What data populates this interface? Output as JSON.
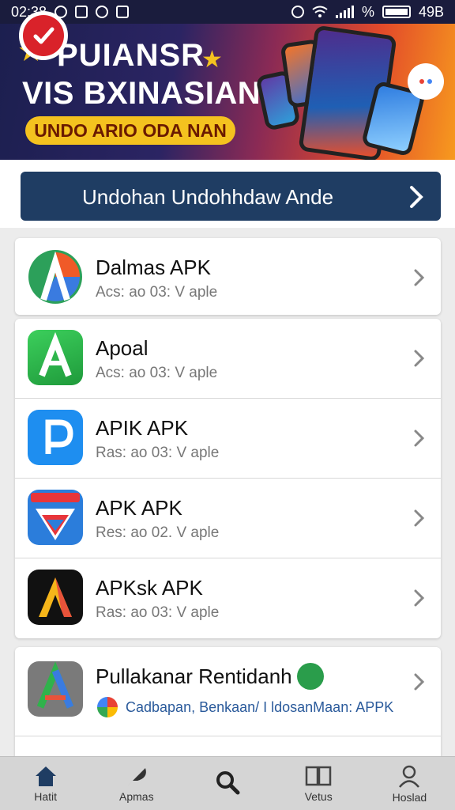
{
  "status_bar": {
    "time": "02:38",
    "battery_percent": "%",
    "right_text": "49B"
  },
  "banner": {
    "line1": "PUIANSR",
    "line2": "VIS BXINASIAN",
    "sub": "UNDO ARIO ODA NAN"
  },
  "download_bar": {
    "label": "Undohan Undohhdaw Ande"
  },
  "apps": [
    {
      "title": "Dalmas APK",
      "subtitle": "Acs: ao 03: V aple",
      "icon": "triangle-logo-icon"
    },
    {
      "title": "Apoal",
      "subtitle": "Acs: ao 03: V aple",
      "icon": "green-a-icon"
    },
    {
      "title": "APIK APK",
      "subtitle": "Ras: ao 03: V aple",
      "icon": "blue-p-icon"
    },
    {
      "title": "APK APK",
      "subtitle": "Res: ao 02. V aple",
      "icon": "shield-logo-icon"
    },
    {
      "title": "APKsk APK",
      "subtitle": "Ras: ao 03: V aple",
      "icon": "black-a-icon"
    }
  ],
  "featured": {
    "title": "Pullakanar Rentidanh",
    "subtitle": "Cadbapan, Benkaan/ I ldosanMaan: APPK",
    "icon": "gray-a-icon"
  },
  "bottom_nav": [
    {
      "label": "Hatit",
      "icon": "home-icon"
    },
    {
      "label": "Apmas",
      "icon": "feather-icon"
    },
    {
      "label": "",
      "icon": "search-icon"
    },
    {
      "label": "Vetus",
      "icon": "book-icon"
    },
    {
      "label": "Hoslad",
      "icon": "user-icon"
    }
  ],
  "colors": {
    "status_bar": "#1a1c3d",
    "download_bar": "#1f3d63",
    "check_red": "#d9222a",
    "banner_yellow": "#f4c21f"
  }
}
